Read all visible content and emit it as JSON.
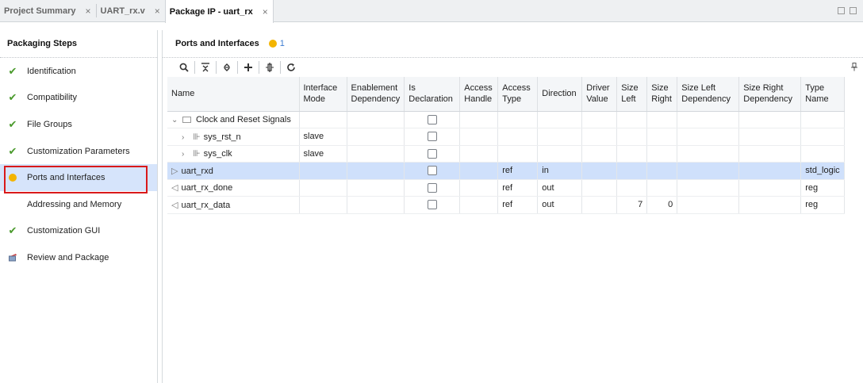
{
  "tabs": [
    {
      "label": "Project Summary",
      "close": "×",
      "active": false
    },
    {
      "label": "UART_rx.v",
      "close": "×",
      "active": false
    },
    {
      "label": "Package IP - uart_rx",
      "close": "×",
      "active": true
    }
  ],
  "left_panel": {
    "title": "Packaging Steps",
    "steps": [
      {
        "label": "Identification",
        "status": "check"
      },
      {
        "label": "Compatibility",
        "status": "check"
      },
      {
        "label": "File Groups",
        "status": "check"
      },
      {
        "label": "Customization Parameters",
        "status": "check"
      },
      {
        "label": "Ports and Interfaces",
        "status": "warning",
        "selected": true
      },
      {
        "label": "Addressing and Memory",
        "status": "none"
      },
      {
        "label": "Customization GUI",
        "status": "check"
      },
      {
        "label": "Review and Package",
        "status": "package"
      }
    ]
  },
  "right_panel": {
    "title": "Ports and Interfaces",
    "warning_count": "1",
    "toolbar_icons": [
      "search-icon",
      "collapse-all-icon",
      "expand-all-icon",
      "add-icon",
      "port-icon",
      "refresh-icon"
    ],
    "columns": [
      "Name",
      "Interface Mode",
      "Enablement Dependency",
      "Is Declaration",
      "Access Handle",
      "Access Type",
      "Direction",
      "Driver Value",
      "Size Left",
      "Size Right",
      "Size Left Dependency",
      "Size Right Dependency",
      "Type Name"
    ],
    "rows": [
      {
        "name": "Clock and Reset Signals",
        "kind": "group",
        "mode": "",
        "access_type": "",
        "direction": "",
        "size_left": "",
        "size_right": "",
        "type_name": ""
      },
      {
        "name": "sys_rst_n",
        "kind": "interface",
        "mode": "slave",
        "access_type": "",
        "direction": "",
        "size_left": "",
        "size_right": "",
        "type_name": ""
      },
      {
        "name": "sys_clk",
        "kind": "interface",
        "mode": "slave",
        "access_type": "",
        "direction": "",
        "size_left": "",
        "size_right": "",
        "type_name": ""
      },
      {
        "name": "uart_rxd",
        "kind": "in",
        "mode": "",
        "access_type": "ref",
        "direction": "in",
        "size_left": "",
        "size_right": "",
        "type_name": "std_logic"
      },
      {
        "name": "uart_rx_done",
        "kind": "out",
        "mode": "",
        "access_type": "ref",
        "direction": "out",
        "size_left": "",
        "size_right": "",
        "type_name": "reg"
      },
      {
        "name": "uart_rx_data",
        "kind": "out",
        "mode": "",
        "access_type": "ref",
        "direction": "out",
        "size_left": "7",
        "size_right": "0",
        "type_name": "reg"
      }
    ]
  },
  "colors": {
    "check": "#4a9a2c",
    "warning": "#f3b400",
    "selection": "#cfe0fb",
    "highlight_box": "#d9191a"
  }
}
